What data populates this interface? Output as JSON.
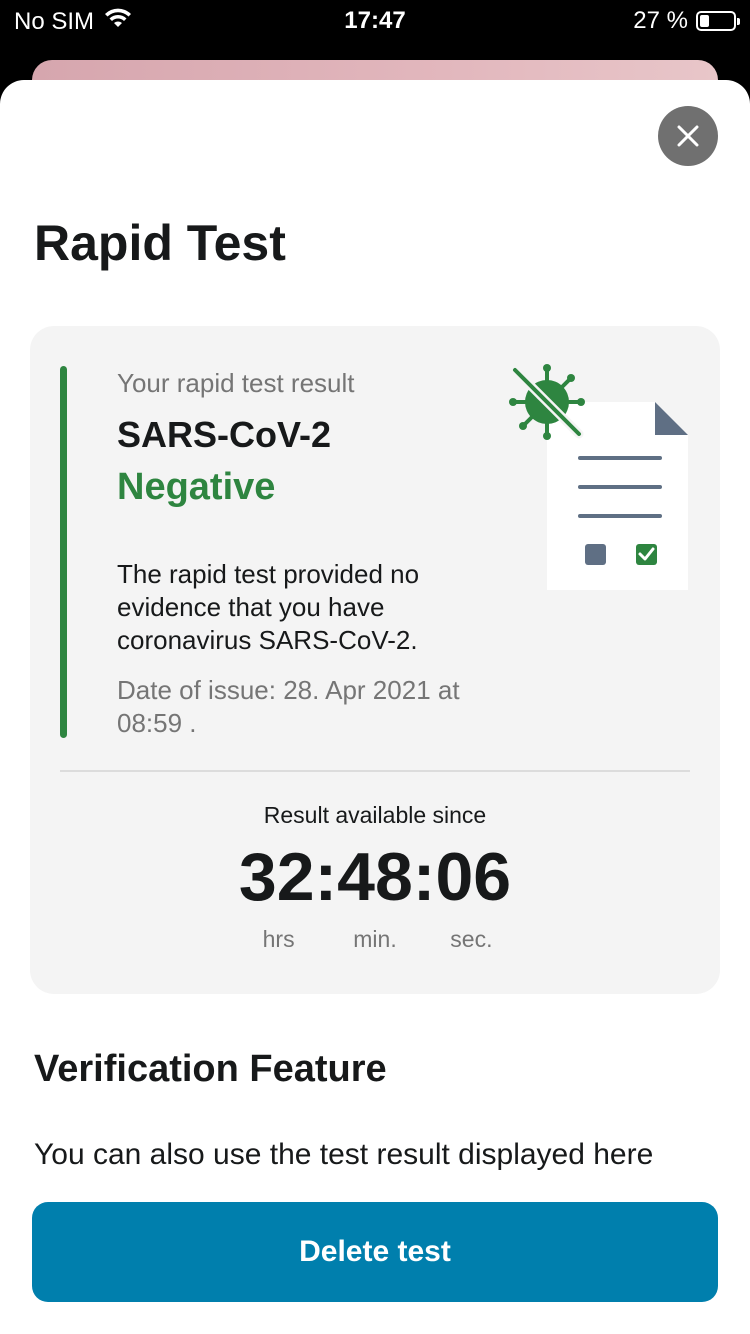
{
  "status_bar": {
    "carrier": "No SIM",
    "time": "17:47",
    "battery": "27 %",
    "battery_level": 0.27,
    "wifi_icon": "wifi-icon",
    "battery_icon": "battery-icon"
  },
  "header": {
    "title": "Rapid Test",
    "close_icon": "close-icon"
  },
  "result_card": {
    "subtitle": "Your rapid test result",
    "virus": "SARS-CoV-2",
    "status": "Negative",
    "description": "The rapid test provided no evidence that you have coronavirus SARS-CoV-2.",
    "issue_date": "Date of issue: 28. Apr 2021 at 08:59 .",
    "illustration_icon": "test-result-document-icon",
    "accent_color": "#2e8540"
  },
  "timer": {
    "caption": "Result available since",
    "value": "32:48:06",
    "units": {
      "hours": "hrs",
      "minutes": "min.",
      "seconds": "sec."
    }
  },
  "verification": {
    "heading": "Verification Feature",
    "text": "You can also use the test result displayed here"
  },
  "actions": {
    "delete_label": "Delete test",
    "button_color": "#007fad"
  }
}
